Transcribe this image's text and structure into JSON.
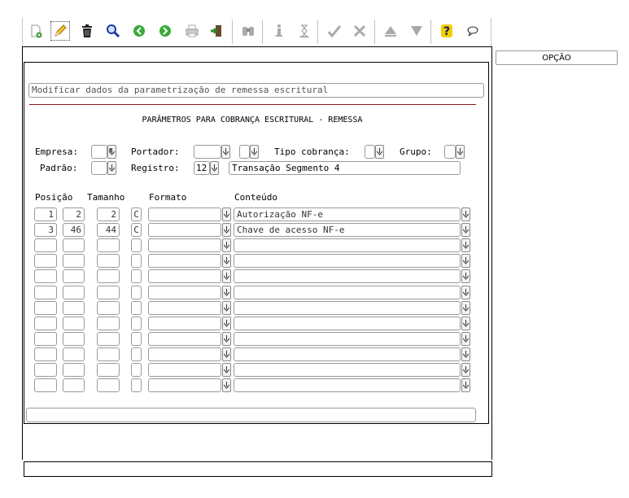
{
  "toolbar": {
    "icons": [
      "new-doc-icon",
      "edit-pencil-icon",
      "delete-trash-icon",
      "search-magnifier-icon",
      "prev-arrow-icon",
      "next-arrow-icon",
      "print-icon",
      "exit-door-icon",
      "binoculars-icon",
      "info-icon",
      "hourglass-icon",
      "confirm-check-icon",
      "cancel-x-icon",
      "first-triangle-icon",
      "last-triangle-icon",
      "help-question-icon",
      "comment-bubble-icon"
    ]
  },
  "side": {
    "opcao_label": "OPÇÃO"
  },
  "header": {
    "description": "Modificar dados da parametrização de remessa escritural",
    "title": "PARÂMETROS PARA COBRANÇA ESCRITURAL - REMESSA"
  },
  "form": {
    "empresa_label": "Empresa:",
    "portador_label": "Portador:",
    "tipo_cobranca_label": "Tipo cobrança:",
    "grupo_label": "Grupo:",
    "padrao_label": "Padrão:",
    "registro_label": "Registro:",
    "registro_value": "12",
    "registro_desc": "Transação Segmento 4"
  },
  "grid": {
    "headers": {
      "posicao": "Posição",
      "tamanho": "Tamanho",
      "formato": "Formato",
      "conteudo": "Conteúdo"
    },
    "rows": [
      {
        "posicao": "1",
        "fim": "2",
        "tamanho": "2",
        "tipo": "C",
        "formato": "",
        "conteudo": "Autorização NF-e"
      },
      {
        "posicao": "3",
        "fim": "46",
        "tamanho": "44",
        "tipo": "C",
        "formato": "",
        "conteudo": "Chave de acesso NF-e"
      },
      {
        "posicao": "",
        "fim": "",
        "tamanho": "",
        "tipo": "",
        "formato": "",
        "conteudo": ""
      },
      {
        "posicao": "",
        "fim": "",
        "tamanho": "",
        "tipo": "",
        "formato": "",
        "conteudo": ""
      },
      {
        "posicao": "",
        "fim": "",
        "tamanho": "",
        "tipo": "",
        "formato": "",
        "conteudo": ""
      },
      {
        "posicao": "",
        "fim": "",
        "tamanho": "",
        "tipo": "",
        "formato": "",
        "conteudo": ""
      },
      {
        "posicao": "",
        "fim": "",
        "tamanho": "",
        "tipo": "",
        "formato": "",
        "conteudo": ""
      },
      {
        "posicao": "",
        "fim": "",
        "tamanho": "",
        "tipo": "",
        "formato": "",
        "conteudo": ""
      },
      {
        "posicao": "",
        "fim": "",
        "tamanho": "",
        "tipo": "",
        "formato": "",
        "conteudo": ""
      },
      {
        "posicao": "",
        "fim": "",
        "tamanho": "",
        "tipo": "",
        "formato": "",
        "conteudo": ""
      },
      {
        "posicao": "",
        "fim": "",
        "tamanho": "",
        "tipo": "",
        "formato": "",
        "conteudo": ""
      },
      {
        "posicao": "",
        "fim": "",
        "tamanho": "",
        "tipo": "",
        "formato": "",
        "conteudo": ""
      }
    ]
  },
  "status": {
    "message": ""
  }
}
